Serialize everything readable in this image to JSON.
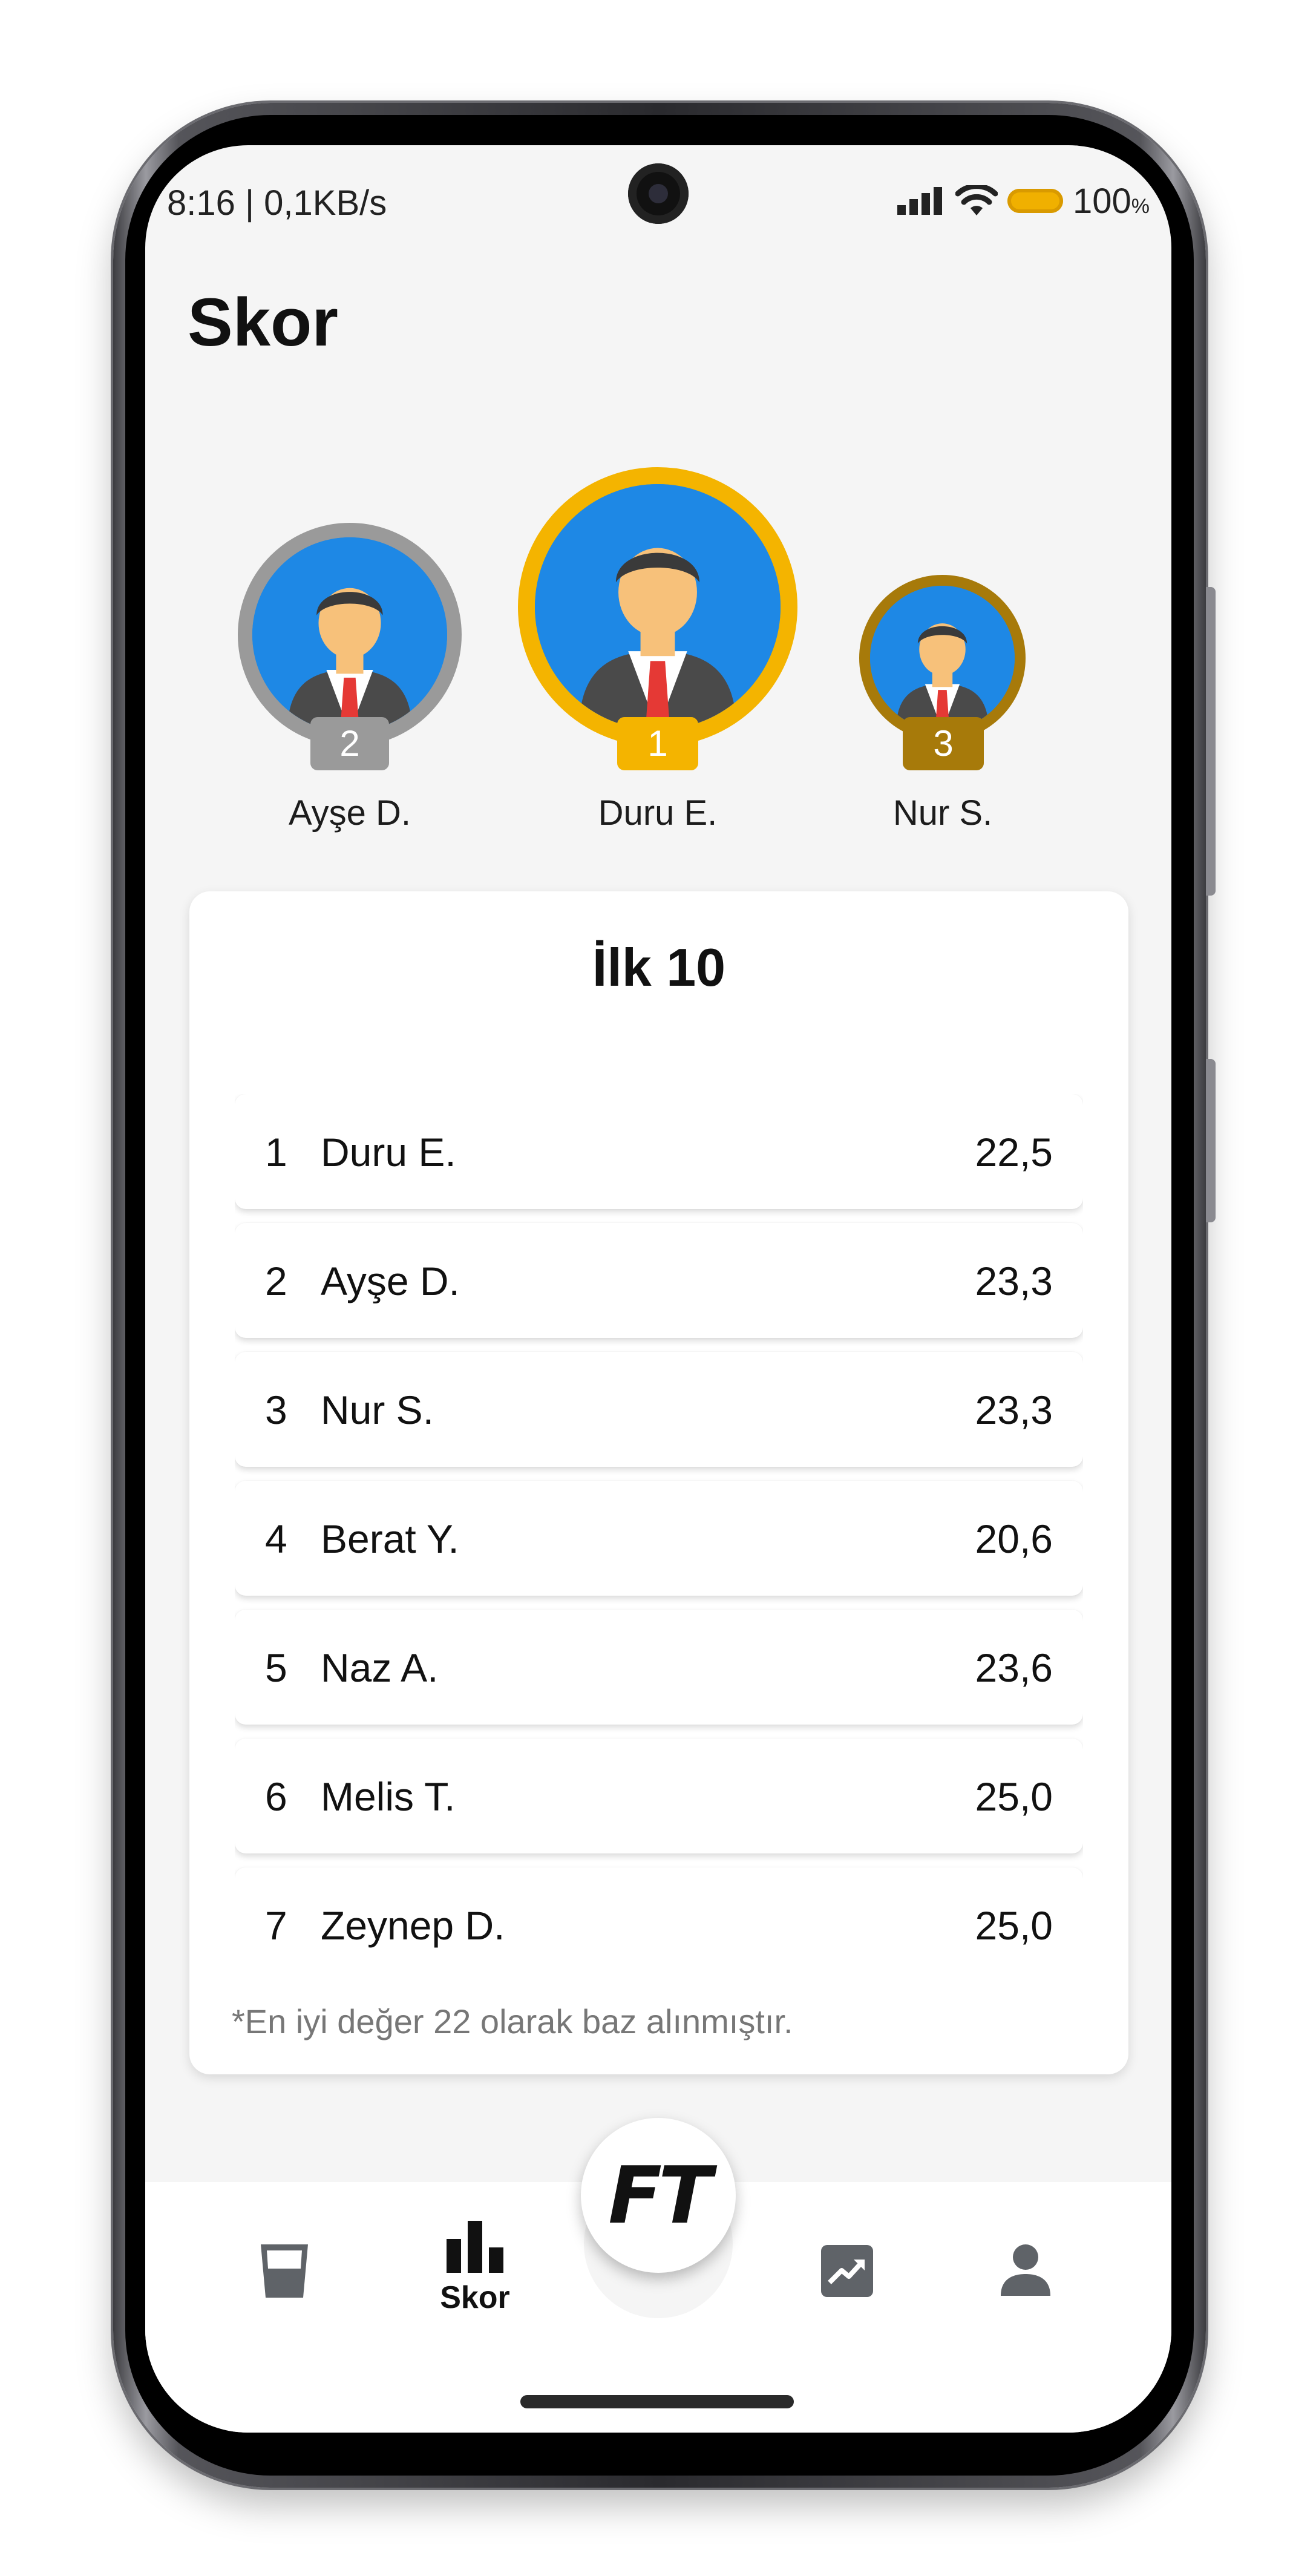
{
  "status": {
    "time_speed": "8:16 | 0,1KB/s",
    "battery": "100",
    "battery_unit": "%"
  },
  "header": {
    "title": "Skor"
  },
  "podium": [
    {
      "rank": "2",
      "name": "Ayşe D.",
      "color": "#9a9a9a",
      "badge_color": "#9a9a9a"
    },
    {
      "rank": "1",
      "name": "Duru E.",
      "color": "#f4b400",
      "badge_color": "#f4b400"
    },
    {
      "rank": "3",
      "name": "Nur S.",
      "color": "#a77a0a",
      "badge_color": "#a77a0a"
    }
  ],
  "top10": {
    "title": "İlk 10",
    "rows": [
      {
        "rank": "1",
        "name": "Duru E.",
        "score": "22,5"
      },
      {
        "rank": "2",
        "name": "Ayşe D.",
        "score": "23,3"
      },
      {
        "rank": "3",
        "name": "Nur S.",
        "score": "23,3"
      },
      {
        "rank": "4",
        "name": "Berat Y.",
        "score": "20,6"
      },
      {
        "rank": "5",
        "name": "Naz A.",
        "score": "23,6"
      },
      {
        "rank": "6",
        "name": "Melis T.",
        "score": "25,0"
      },
      {
        "rank": "7",
        "name": "Zeynep D.",
        "score": "25,0"
      }
    ],
    "footnote": "*En iyi değer 22 olarak baz alınmıştır."
  },
  "bottom_nav": {
    "items": [
      {
        "icon": "glass-icon",
        "label": ""
      },
      {
        "icon": "bar-chart-icon",
        "label": "Skor",
        "active": true
      },
      {
        "icon": "trending-up-icon",
        "label": ""
      },
      {
        "icon": "person-icon",
        "label": ""
      }
    ],
    "fab_logo": "FT"
  },
  "colors": {
    "gold": "#f4b400",
    "silver": "#9a9a9a",
    "bronze": "#a77a0a",
    "avatar_bg": "#1e88e5"
  }
}
